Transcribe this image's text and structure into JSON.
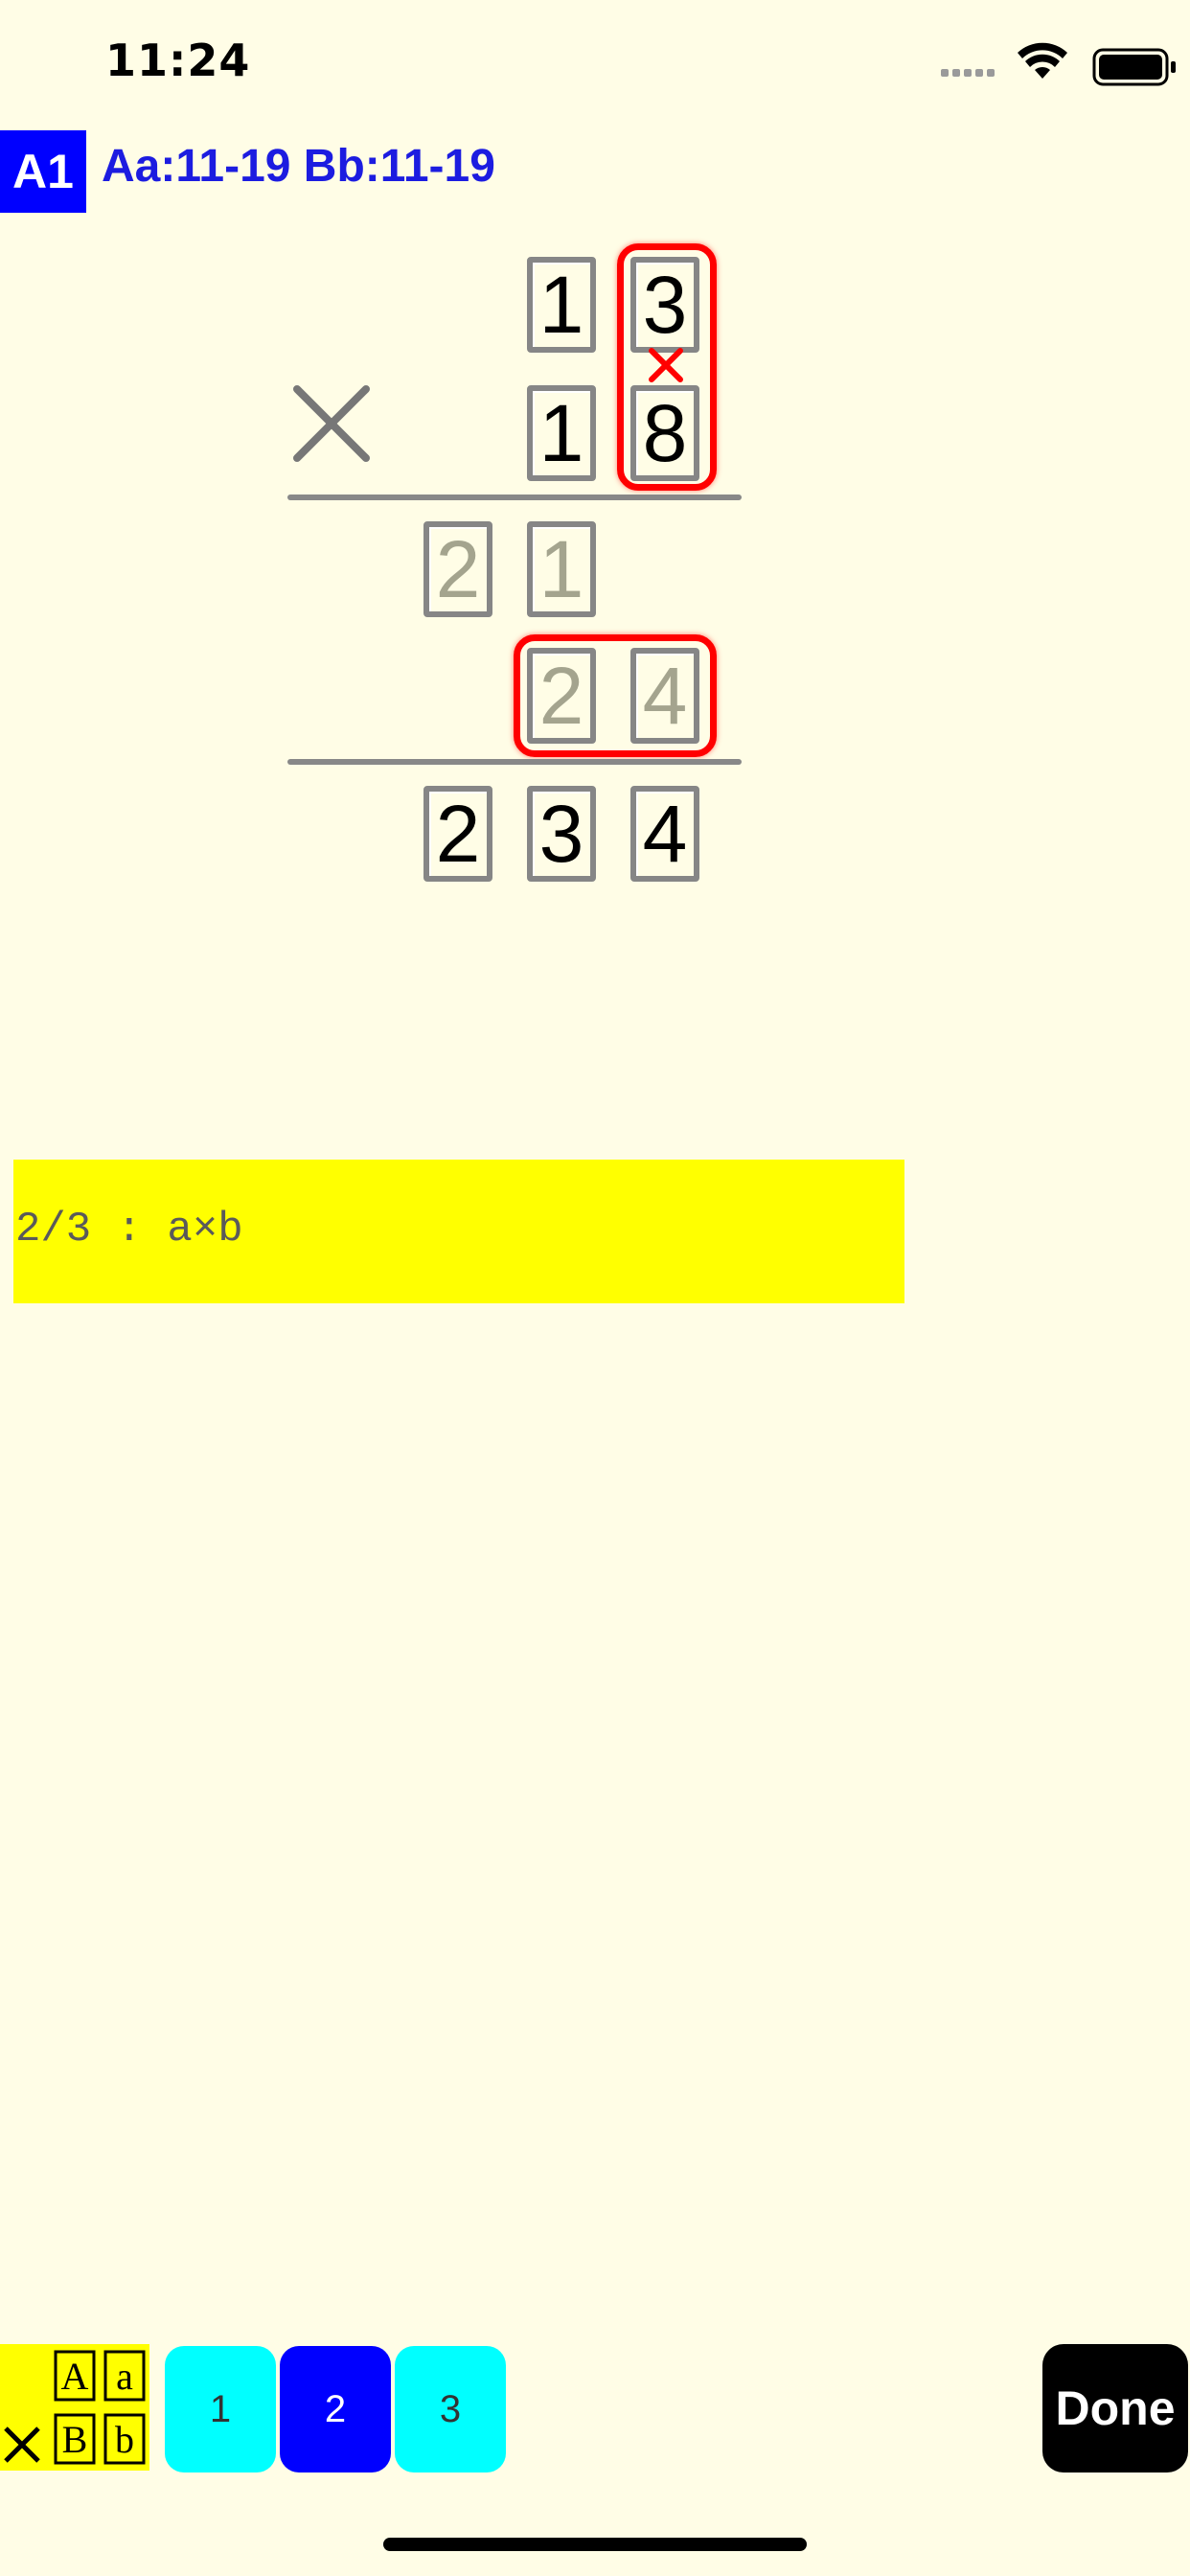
{
  "status_bar": {
    "time": "11:24"
  },
  "header": {
    "level": "A1",
    "range": "Aa:11-19 Bb:11-19"
  },
  "problem": {
    "multiplicand": [
      "1",
      "3"
    ],
    "multiplier": [
      "1",
      "8"
    ],
    "operator": "×",
    "partial_1": [
      "2",
      "1"
    ],
    "partial_2": [
      "2",
      "4"
    ],
    "answer": [
      "2",
      "3",
      "4"
    ],
    "step_mark": "×"
  },
  "prompt": {
    "text": "2/3 : a×b"
  },
  "toolbar": {
    "op_tile": {
      "operator": "×",
      "top_left": "A",
      "top_right": "a",
      "bottom_left": "B",
      "bottom_right": "b"
    },
    "steps": [
      "1",
      "2",
      "3"
    ],
    "active_step": "2",
    "done_label": "Done"
  },
  "colors": {
    "background": "#FFFDE6",
    "badge": "#0000FF",
    "highlight": "#FF0000",
    "prompt_bg": "#FFFF00",
    "step_inactive": "#00FFFF",
    "step_active": "#0000FF"
  }
}
